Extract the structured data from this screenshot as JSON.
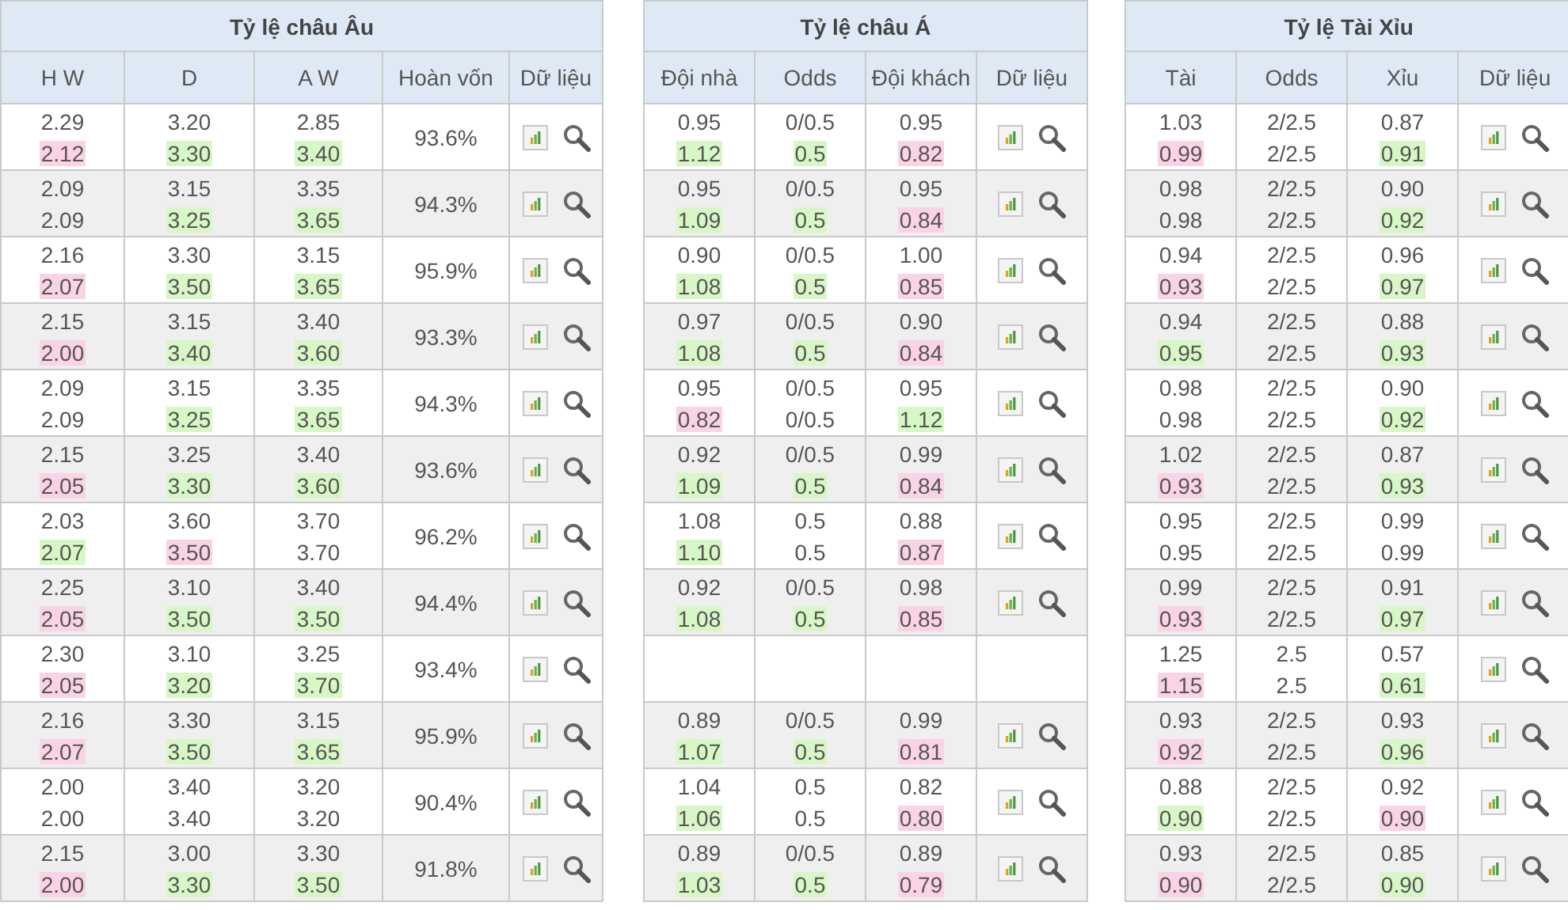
{
  "tables": [
    {
      "title": "Tỷ lệ châu Âu",
      "columns": [
        "H W",
        "D",
        "A W",
        "Hoàn vốn",
        "Dữ liệu"
      ],
      "rows": [
        {
          "kind": "odds",
          "cells": [
            {
              "open": "2.29",
              "close": "2.12",
              "color": "#fad3e6"
            },
            {
              "open": "3.20",
              "close": "3.30",
              "color": "#d8f7c6"
            },
            {
              "open": "2.85",
              "close": "3.40",
              "color": "#d8f7c6"
            }
          ],
          "payout": "93.6%"
        },
        {
          "kind": "odds",
          "cells": [
            {
              "open": "2.09",
              "close": "2.09"
            },
            {
              "open": "3.15",
              "close": "3.25",
              "color": "#d8f7c6"
            },
            {
              "open": "3.35",
              "close": "3.65",
              "color": "#d8f7c6"
            }
          ],
          "payout": "94.3%"
        },
        {
          "kind": "odds",
          "cells": [
            {
              "open": "2.16",
              "close": "2.07",
              "color": "#fad3e6"
            },
            {
              "open": "3.30",
              "close": "3.50",
              "color": "#d8f7c6"
            },
            {
              "open": "3.15",
              "close": "3.65",
              "color": "#d8f7c6"
            }
          ],
          "payout": "95.9%"
        },
        {
          "kind": "odds",
          "cells": [
            {
              "open": "2.15",
              "close": "2.00",
              "color": "#fad3e6"
            },
            {
              "open": "3.15",
              "close": "3.40",
              "color": "#d8f7c6"
            },
            {
              "open": "3.40",
              "close": "3.60",
              "color": "#d8f7c6"
            }
          ],
          "payout": "93.3%"
        },
        {
          "kind": "odds",
          "cells": [
            {
              "open": "2.09",
              "close": "2.09"
            },
            {
              "open": "3.15",
              "close": "3.25",
              "color": "#d8f7c6"
            },
            {
              "open": "3.35",
              "close": "3.65",
              "color": "#d8f7c6"
            }
          ],
          "payout": "94.3%"
        },
        {
          "kind": "odds",
          "cells": [
            {
              "open": "2.15",
              "close": "2.05",
              "color": "#fad3e6"
            },
            {
              "open": "3.25",
              "close": "3.30",
              "color": "#d8f7c6"
            },
            {
              "open": "3.40",
              "close": "3.60",
              "color": "#d8f7c6"
            }
          ],
          "payout": "93.6%"
        },
        {
          "kind": "odds",
          "cells": [
            {
              "open": "2.03",
              "close": "2.07",
              "color": "#d8f7c6"
            },
            {
              "open": "3.60",
              "close": "3.50",
              "color": "#fad3e6"
            },
            {
              "open": "3.70",
              "close": "3.70"
            }
          ],
          "payout": "96.2%"
        },
        {
          "kind": "odds",
          "cells": [
            {
              "open": "2.25",
              "close": "2.05",
              "color": "#fad3e6"
            },
            {
              "open": "3.10",
              "close": "3.50",
              "color": "#d8f7c6"
            },
            {
              "open": "3.40",
              "close": "3.50",
              "color": "#d8f7c6"
            }
          ],
          "payout": "94.4%"
        },
        {
          "kind": "odds",
          "cells": [
            {
              "open": "2.30",
              "close": "2.05",
              "color": "#fad3e6"
            },
            {
              "open": "3.10",
              "close": "3.20",
              "color": "#d8f7c6"
            },
            {
              "open": "3.25",
              "close": "3.70",
              "color": "#d8f7c6"
            }
          ],
          "payout": "93.4%"
        },
        {
          "kind": "odds",
          "cells": [
            {
              "open": "2.16",
              "close": "2.07",
              "color": "#fad3e6"
            },
            {
              "open": "3.30",
              "close": "3.50",
              "color": "#d8f7c6"
            },
            {
              "open": "3.15",
              "close": "3.65",
              "color": "#d8f7c6"
            }
          ],
          "payout": "95.9%"
        },
        {
          "kind": "odds",
          "cells": [
            {
              "open": "2.00",
              "close": "2.00"
            },
            {
              "open": "3.40",
              "close": "3.40"
            },
            {
              "open": "3.20",
              "close": "3.20"
            }
          ],
          "payout": "90.4%"
        },
        {
          "kind": "odds",
          "cells": [
            {
              "open": "2.15",
              "close": "2.00",
              "color": "#fad3e6"
            },
            {
              "open": "3.00",
              "close": "3.30",
              "color": "#d8f7c6"
            },
            {
              "open": "3.30",
              "close": "3.50",
              "color": "#d8f7c6"
            }
          ],
          "payout": "91.8%"
        }
      ]
    },
    {
      "title": "Tỷ lệ châu Á",
      "columns": [
        "Đội nhà",
        "Odds",
        "Đội khách",
        "Dữ liệu"
      ],
      "rows": [
        {
          "kind": "odds",
          "cells": [
            {
              "open": "0.95",
              "close": "1.12",
              "color": "#d8f7c6"
            },
            {
              "open": "0/0.5",
              "close": "0.5",
              "color": "#d8f7c6"
            },
            {
              "open": "0.95",
              "close": "0.82",
              "color": "#fad3e6"
            }
          ]
        },
        {
          "kind": "odds",
          "cells": [
            {
              "open": "0.95",
              "close": "1.09",
              "color": "#d8f7c6"
            },
            {
              "open": "0/0.5",
              "close": "0.5",
              "color": "#d8f7c6"
            },
            {
              "open": "0.95",
              "close": "0.84",
              "color": "#fad3e6"
            }
          ]
        },
        {
          "kind": "odds",
          "cells": [
            {
              "open": "0.90",
              "close": "1.08",
              "color": "#d8f7c6"
            },
            {
              "open": "0/0.5",
              "close": "0.5",
              "color": "#d8f7c6"
            },
            {
              "open": "1.00",
              "close": "0.85",
              "color": "#fad3e6"
            }
          ]
        },
        {
          "kind": "odds",
          "cells": [
            {
              "open": "0.97",
              "close": "1.08",
              "color": "#d8f7c6"
            },
            {
              "open": "0/0.5",
              "close": "0.5",
              "color": "#d8f7c6"
            },
            {
              "open": "0.90",
              "close": "0.84",
              "color": "#fad3e6"
            }
          ]
        },
        {
          "kind": "odds",
          "cells": [
            {
              "open": "0.95",
              "close": "0.82",
              "color": "#fad3e6"
            },
            {
              "open": "0/0.5",
              "close": "0/0.5"
            },
            {
              "open": "0.95",
              "close": "1.12",
              "color": "#d8f7c6"
            }
          ]
        },
        {
          "kind": "odds",
          "cells": [
            {
              "open": "0.92",
              "close": "1.09",
              "color": "#d8f7c6"
            },
            {
              "open": "0/0.5",
              "close": "0.5",
              "color": "#d8f7c6"
            },
            {
              "open": "0.99",
              "close": "0.84",
              "color": "#fad3e6"
            }
          ]
        },
        {
          "kind": "odds",
          "cells": [
            {
              "open": "1.08",
              "close": "1.10",
              "color": "#d8f7c6"
            },
            {
              "open": "0.5",
              "close": "0.5"
            },
            {
              "open": "0.88",
              "close": "0.87",
              "color": "#fad3e6"
            }
          ]
        },
        {
          "kind": "odds",
          "cells": [
            {
              "open": "0.92",
              "close": "1.08",
              "color": "#d8f7c6"
            },
            {
              "open": "0/0.5",
              "close": "0.5",
              "color": "#d8f7c6"
            },
            {
              "open": "0.98",
              "close": "0.85",
              "color": "#fad3e6"
            }
          ]
        },
        {
          "kind": "empty"
        },
        {
          "kind": "odds",
          "cells": [
            {
              "open": "0.89",
              "close": "1.07",
              "color": "#d8f7c6"
            },
            {
              "open": "0/0.5",
              "close": "0.5",
              "color": "#d8f7c6"
            },
            {
              "open": "0.99",
              "close": "0.81",
              "color": "#fad3e6"
            }
          ]
        },
        {
          "kind": "odds",
          "cells": [
            {
              "open": "1.04",
              "close": "1.06",
              "color": "#d8f7c6"
            },
            {
              "open": "0.5",
              "close": "0.5"
            },
            {
              "open": "0.82",
              "close": "0.80",
              "color": "#fad3e6"
            }
          ]
        },
        {
          "kind": "odds",
          "cells": [
            {
              "open": "0.89",
              "close": "1.03",
              "color": "#d8f7c6"
            },
            {
              "open": "0/0.5",
              "close": "0.5",
              "color": "#d8f7c6"
            },
            {
              "open": "0.89",
              "close": "0.79",
              "color": "#fad3e6"
            }
          ]
        }
      ]
    },
    {
      "title": "Tỷ lệ Tài Xỉu",
      "columns": [
        "Tài",
        "Odds",
        "Xỉu",
        "Dữ liệu"
      ],
      "rows": [
        {
          "kind": "odds",
          "cells": [
            {
              "open": "1.03",
              "close": "0.99",
              "color": "#fad3e6"
            },
            {
              "open": "2/2.5",
              "close": "2/2.5"
            },
            {
              "open": "0.87",
              "close": "0.91",
              "color": "#d8f7c6"
            }
          ]
        },
        {
          "kind": "odds",
          "cells": [
            {
              "open": "0.98",
              "close": "0.98"
            },
            {
              "open": "2/2.5",
              "close": "2/2.5"
            },
            {
              "open": "0.90",
              "close": "0.92",
              "color": "#d8f7c6"
            }
          ]
        },
        {
          "kind": "odds",
          "cells": [
            {
              "open": "0.94",
              "close": "0.93",
              "color": "#fad3e6"
            },
            {
              "open": "2/2.5",
              "close": "2/2.5"
            },
            {
              "open": "0.96",
              "close": "0.97",
              "color": "#d8f7c6"
            }
          ]
        },
        {
          "kind": "odds",
          "cells": [
            {
              "open": "0.94",
              "close": "0.95",
              "color": "#d8f7c6"
            },
            {
              "open": "2/2.5",
              "close": "2/2.5"
            },
            {
              "open": "0.88",
              "close": "0.93",
              "color": "#d8f7c6"
            }
          ]
        },
        {
          "kind": "odds",
          "cells": [
            {
              "open": "0.98",
              "close": "0.98"
            },
            {
              "open": "2/2.5",
              "close": "2/2.5"
            },
            {
              "open": "0.90",
              "close": "0.92",
              "color": "#d8f7c6"
            }
          ]
        },
        {
          "kind": "odds",
          "cells": [
            {
              "open": "1.02",
              "close": "0.93",
              "color": "#fad3e6"
            },
            {
              "open": "2/2.5",
              "close": "2/2.5"
            },
            {
              "open": "0.87",
              "close": "0.93",
              "color": "#d8f7c6"
            }
          ]
        },
        {
          "kind": "odds",
          "cells": [
            {
              "open": "0.95",
              "close": "0.95"
            },
            {
              "open": "2/2.5",
              "close": "2/2.5"
            },
            {
              "open": "0.99",
              "close": "0.99"
            }
          ]
        },
        {
          "kind": "odds",
          "cells": [
            {
              "open": "0.99",
              "close": "0.93",
              "color": "#fad3e6"
            },
            {
              "open": "2/2.5",
              "close": "2/2.5"
            },
            {
              "open": "0.91",
              "close": "0.97",
              "color": "#d8f7c6"
            }
          ]
        },
        {
          "kind": "odds",
          "cells": [
            {
              "open": "1.25",
              "close": "1.15",
              "color": "#fad3e6"
            },
            {
              "open": "2.5",
              "close": "2.5"
            },
            {
              "open": "0.57",
              "close": "0.61",
              "color": "#d8f7c6"
            }
          ]
        },
        {
          "kind": "odds",
          "cells": [
            {
              "open": "0.93",
              "close": "0.92",
              "color": "#fad3e6"
            },
            {
              "open": "2/2.5",
              "close": "2/2.5"
            },
            {
              "open": "0.93",
              "close": "0.96",
              "color": "#d8f7c6"
            }
          ]
        },
        {
          "kind": "odds",
          "cells": [
            {
              "open": "0.88",
              "close": "0.90",
              "color": "#d8f7c6"
            },
            {
              "open": "2/2.5",
              "close": "2/2.5"
            },
            {
              "open": "0.92",
              "close": "0.90",
              "color": "#fad3e6"
            }
          ]
        },
        {
          "kind": "odds",
          "cells": [
            {
              "open": "0.93",
              "close": "0.90",
              "color": "#fad3e6"
            },
            {
              "open": "2/2.5",
              "close": "2/2.5"
            },
            {
              "open": "0.85",
              "close": "0.90",
              "color": "#d8f7c6"
            }
          ]
        }
      ]
    }
  ]
}
